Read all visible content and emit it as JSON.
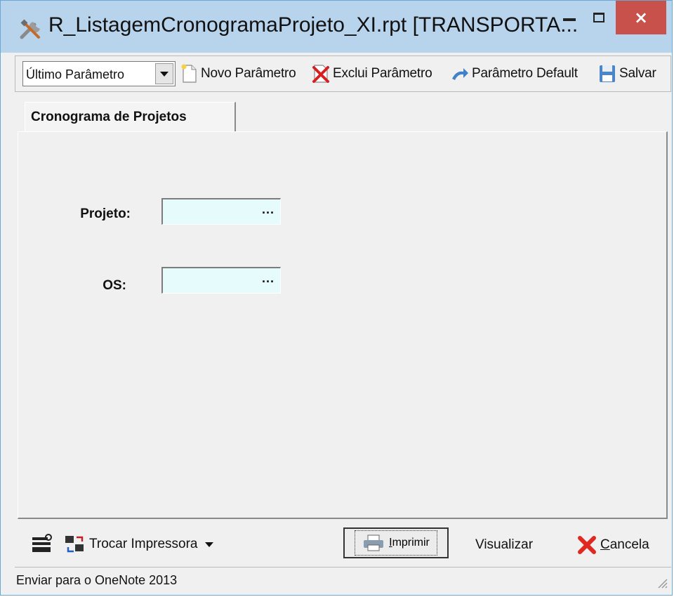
{
  "window": {
    "title": "R_ListagemCronogramaProjeto_XI.rpt [TRANSPORTA...",
    "close_label": "×"
  },
  "toolbar": {
    "parameter_select_value": "Último Parâmetro",
    "new_parameter_label": "Novo Parâmetro",
    "delete_parameter_label": "Exclui Parâmetro",
    "default_parameter_label": "Parâmetro Default",
    "save_label": "Salvar"
  },
  "tabs": [
    {
      "label": "Cronograma de Projetos",
      "active": true
    }
  ],
  "form": {
    "projeto_label": "Projeto:",
    "projeto_value": "",
    "os_label": "OS:",
    "os_value": "",
    "lookup_button": "..."
  },
  "bottom": {
    "change_printer_label": "Trocar Impressora",
    "print_label": "Imprimir",
    "preview_label": "Visualizar",
    "cancel_label": "Cancela"
  },
  "status": {
    "text": "Enviar para o OneNote 2013"
  },
  "colors": {
    "titlebar": "#b8d4ec",
    "close_button": "#c9514c",
    "input_background": "#e6fbfb",
    "window_background": "#f0f0f0"
  },
  "icons": {
    "app": "tools-icon",
    "new": "new-document-icon",
    "delete": "delete-document-icon",
    "default": "arrow-icon",
    "save": "floppy-icon",
    "printer_settings": "printer-settings-icon",
    "swap_printer": "swap-printer-icon",
    "print": "printer-icon",
    "cancel": "red-x-icon"
  }
}
